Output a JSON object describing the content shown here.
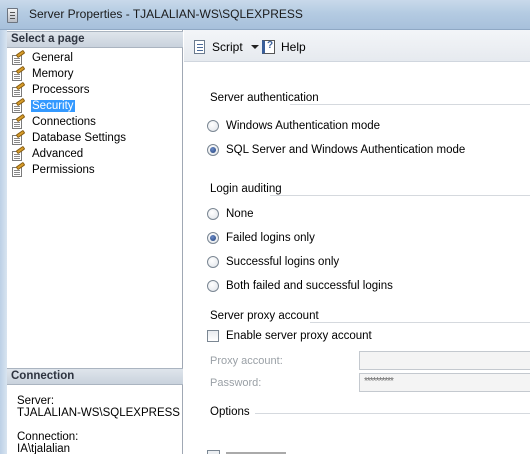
{
  "window": {
    "title": "Server Properties - TJALALIAN-WS\\SQLEXPRESS"
  },
  "left_pane": {
    "select_page_header": "Select a page",
    "pages": [
      {
        "label": "General",
        "selected": false
      },
      {
        "label": "Memory",
        "selected": false
      },
      {
        "label": "Processors",
        "selected": false
      },
      {
        "label": "Security",
        "selected": true
      },
      {
        "label": "Connections",
        "selected": false
      },
      {
        "label": "Database Settings",
        "selected": false
      },
      {
        "label": "Advanced",
        "selected": false
      },
      {
        "label": "Permissions",
        "selected": false
      }
    ],
    "connection_header": "Connection",
    "connection": {
      "server_label": "Server:",
      "server_value": "TJALALIAN-WS\\SQLEXPRESS",
      "connection_label": "Connection:",
      "connection_value": "IA\\tjalalian"
    }
  },
  "toolbar": {
    "script_label": "Script",
    "help_label": "Help"
  },
  "server_authentication": {
    "title": "Server authentication",
    "options": [
      {
        "label": "Windows Authentication mode",
        "checked": false
      },
      {
        "label": "SQL Server and Windows Authentication mode",
        "checked": true
      }
    ]
  },
  "login_auditing": {
    "title": "Login auditing",
    "options": [
      {
        "label": "None",
        "checked": false
      },
      {
        "label": "Failed logins only",
        "checked": true
      },
      {
        "label": "Successful logins only",
        "checked": false
      },
      {
        "label": "Both failed and successful logins",
        "checked": false
      }
    ]
  },
  "proxy": {
    "title": "Server proxy account",
    "enable_label": "Enable server proxy account",
    "enabled": false,
    "account_label": "Proxy account:",
    "account_value": "",
    "password_label": "Password:",
    "password_value": "**********"
  },
  "options": {
    "title": "Options"
  }
}
